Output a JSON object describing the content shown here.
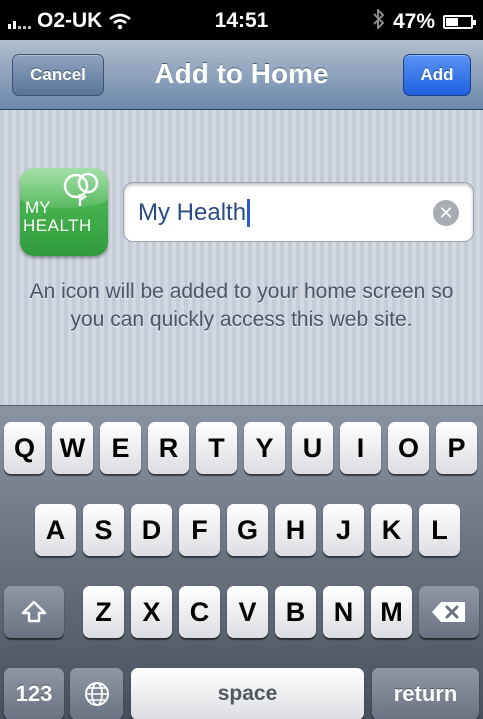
{
  "status_bar": {
    "carrier": "O2-UK",
    "time": "14:51",
    "battery_percent": "47%",
    "battery_level": 0.47,
    "wifi_icon": "wifi-icon",
    "bluetooth_icon": "bluetooth-icon"
  },
  "nav_bar": {
    "title": "Add to Home",
    "cancel_label": "Cancel",
    "add_label": "Add"
  },
  "app_icon": {
    "line1": "MY",
    "line2": "HEALTH"
  },
  "name_field": {
    "value": "My Health",
    "clear_icon": "clear-icon"
  },
  "description": "An icon will be added to your home screen so you can quickly access this web site.",
  "keyboard": {
    "row1": [
      "Q",
      "W",
      "E",
      "R",
      "T",
      "Y",
      "U",
      "I",
      "O",
      "P"
    ],
    "row2": [
      "A",
      "S",
      "D",
      "F",
      "G",
      "H",
      "J",
      "K",
      "L"
    ],
    "row3": [
      "Z",
      "X",
      "C",
      "V",
      "B",
      "N",
      "M"
    ],
    "numbers_label": "123",
    "space_label": "space",
    "return_label": "return",
    "shift_icon": "shift-icon",
    "delete_icon": "backspace-icon",
    "globe_icon": "globe-icon"
  },
  "colors": {
    "nav_accent": "#1e5fe0",
    "keyboard_bg": "#474f5c",
    "icon_green": "#2f9a3a"
  }
}
